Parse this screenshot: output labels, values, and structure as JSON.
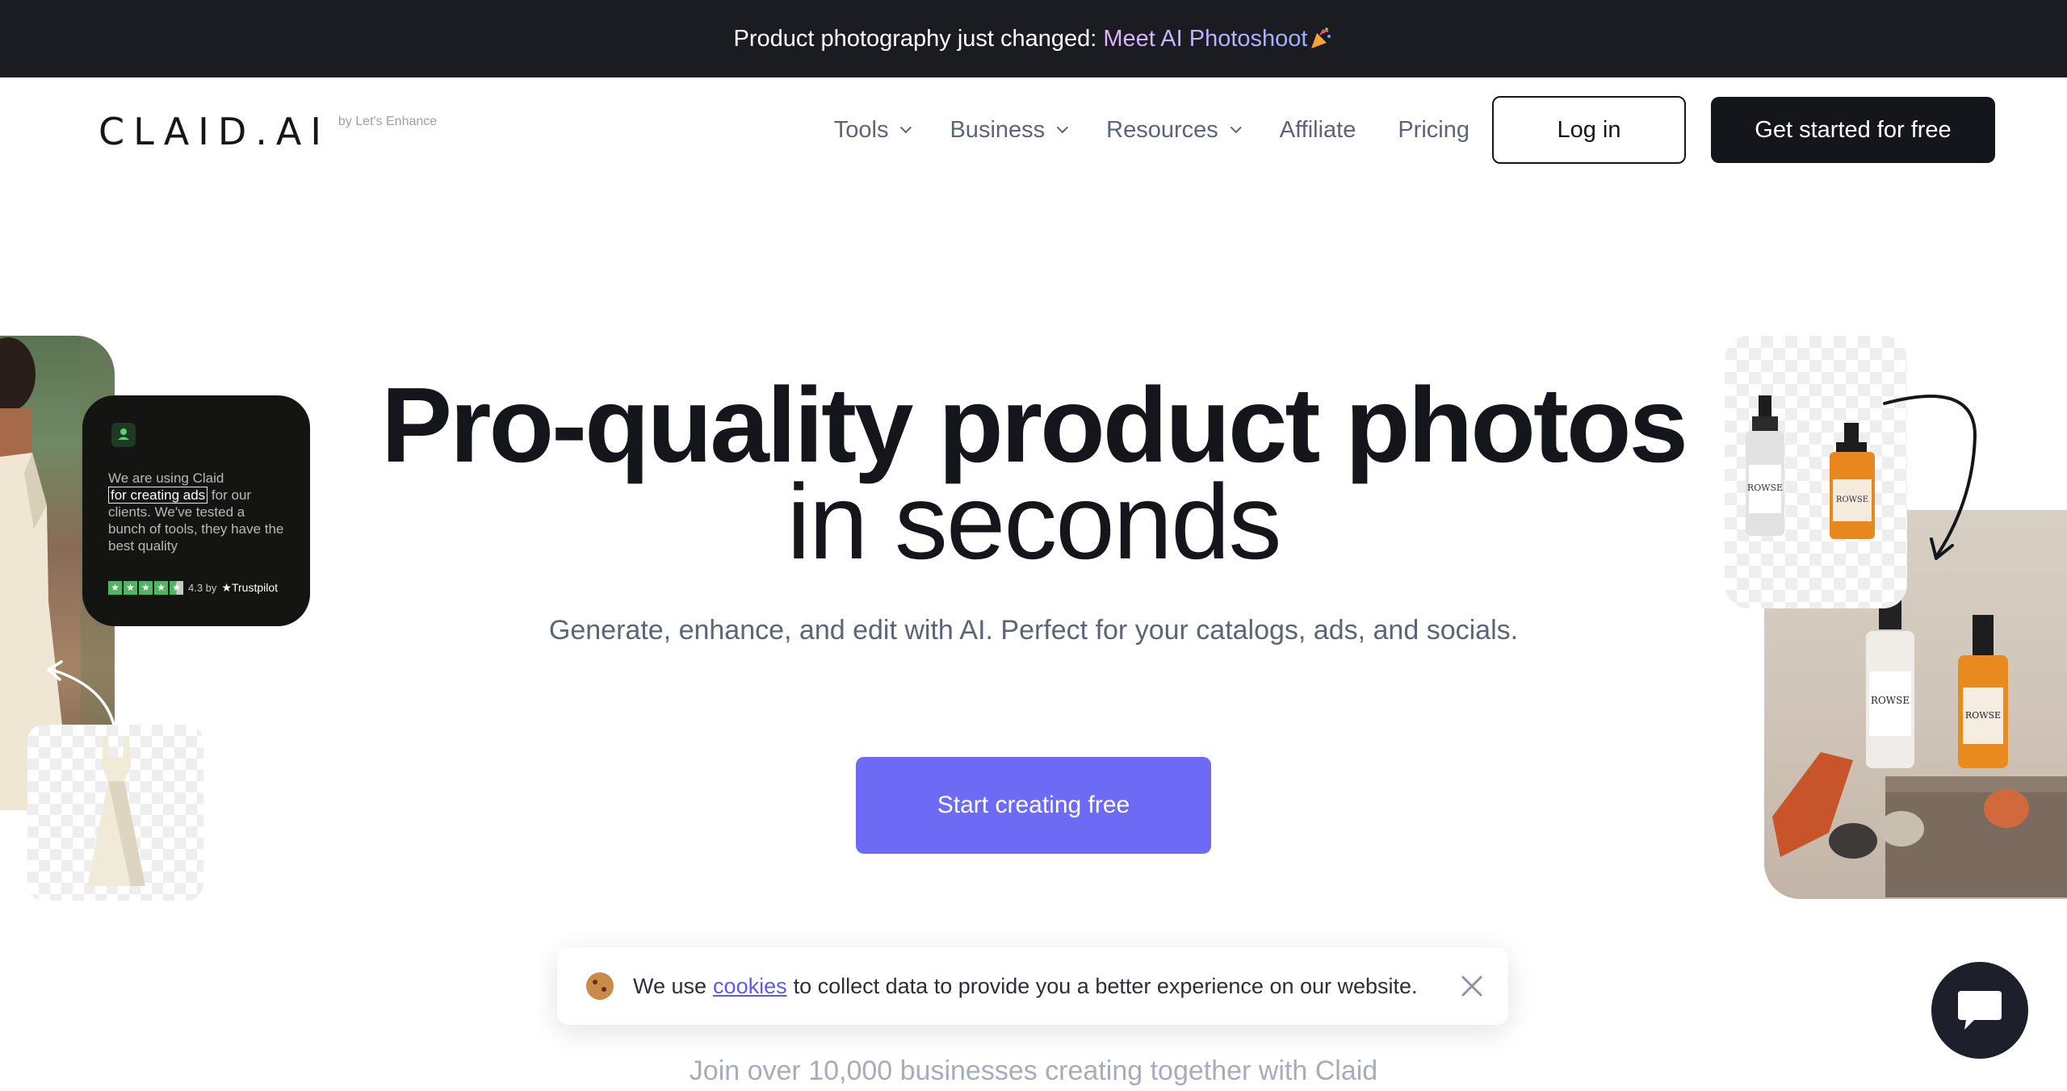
{
  "announcement": {
    "text": "Product photography just changed:",
    "highlight": "Meet AI Photoshoot",
    "emoji": "🎉"
  },
  "header": {
    "logo": "CLAID.AI",
    "logo_sub": "by Let's Enhance",
    "nav": [
      {
        "label": "Tools",
        "has_dropdown": true
      },
      {
        "label": "Business",
        "has_dropdown": true
      },
      {
        "label": "Resources",
        "has_dropdown": true
      },
      {
        "label": "Affiliate",
        "has_dropdown": false
      },
      {
        "label": "Pricing",
        "has_dropdown": false
      }
    ],
    "login_label": "Log in",
    "cta_label": "Get started for free"
  },
  "hero": {
    "title_line1": "Pro-quality product photos",
    "title_line2": "in seconds",
    "subtitle": "Generate, enhance, and edit with AI. Perfect for your catalogs, ads, and socials.",
    "cta_label": "Start creating free",
    "join_text": "Join over 10,000 businesses creating together with Claid"
  },
  "review": {
    "text_before": "We are using Claid",
    "text_highlight": "for creating ads",
    "text_after": "for our clients. We've tested a bunch of tools, they have the best quality",
    "rating": "4.3 by",
    "source": "Trustpilot",
    "stars": 4.5
  },
  "product": {
    "brand_label": "ROWSE"
  },
  "cookie": {
    "text_before": "We use",
    "link": "cookies",
    "text_after": "to collect data to provide you a better experience on our website."
  },
  "colors": {
    "accent": "#6d6af6",
    "dark": "#15161b",
    "muted_text": "#5b6478",
    "announcement_bg": "#1a1c22"
  }
}
